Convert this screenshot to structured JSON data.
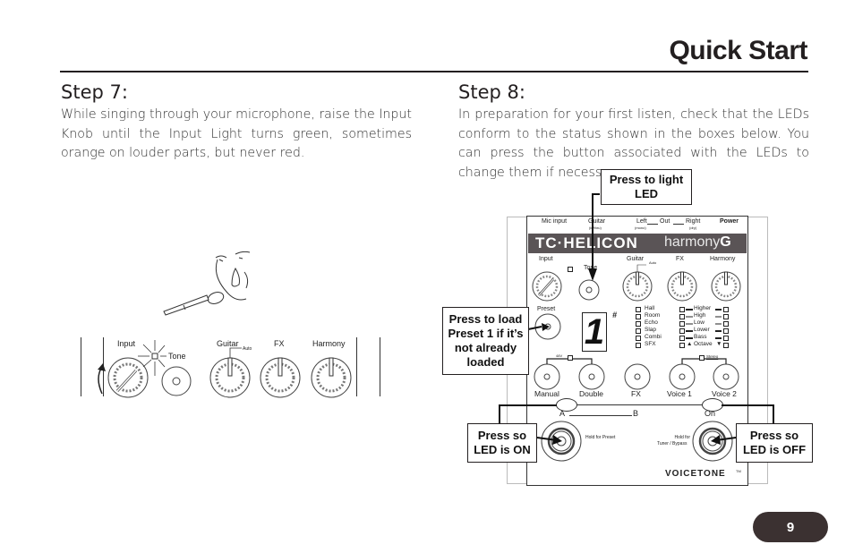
{
  "header": {
    "title": "Quick Start"
  },
  "step7": {
    "title": "Step 7:",
    "body": "While singing through your microphone, raise the Input Knob until the Input Light turns green, sometimes orange on louder parts, but never red.",
    "panel": {
      "knobs": [
        "Input",
        "Tone",
        "Guitar",
        "FX",
        "Harmony"
      ],
      "auto_label": "Auto"
    }
  },
  "step8": {
    "title": "Step 8:",
    "body": "In preparation for your first listen, check that the LEDs conform to the status shown in the boxes below. You can press the button associated with the LEDs to change them if necessary.",
    "callouts": {
      "light_led": "Press to light LED",
      "load_preset": "Press to load Preset 1 if it’s not already loaded",
      "led_on": "Press so LED is ON",
      "led_off": "Press so LED is OFF"
    }
  },
  "device": {
    "jacks": {
      "mic_input": "Mic input",
      "guitar": "Guitar",
      "guitar_sub": "(in/thru)",
      "left": "Left",
      "left_sub": "(mono)",
      "out": "Out",
      "right": "Right",
      "right_sub": "(dry)",
      "power": "Power"
    },
    "brand": "TC·HELICON",
    "model_prefix": "harmony",
    "model_suffix": "G",
    "knobs": {
      "input": "Input",
      "tone": "Tone",
      "guitar": "Guitar",
      "auto": "Auto",
      "fx": "FX",
      "harmony": "Harmony"
    },
    "preset_label": "Preset",
    "preset_display": "1",
    "sharp": "#",
    "fx_types": [
      "Hall",
      "Room",
      "Echo",
      "Slap",
      "Combi",
      "SFX"
    ],
    "harmony_types": [
      "Higher",
      "High",
      "Low",
      "Lower",
      "Bass",
      "Octave"
    ],
    "phantom": "48V",
    "stereo": "Stereo",
    "buttons": [
      "Manual",
      "Double",
      "FX",
      "Voice 1",
      "Voice 2"
    ],
    "footswitch_left": {
      "a": "A",
      "b": "B",
      "hold": "Hold for Preset"
    },
    "footswitch_right": {
      "on": "On",
      "hold_line1": "Hold for",
      "hold_line2": "Tuner / Bypass"
    },
    "voicetone": "VOICETONE",
    "tm": "TM"
  },
  "footer": {
    "page_number": "9"
  }
}
